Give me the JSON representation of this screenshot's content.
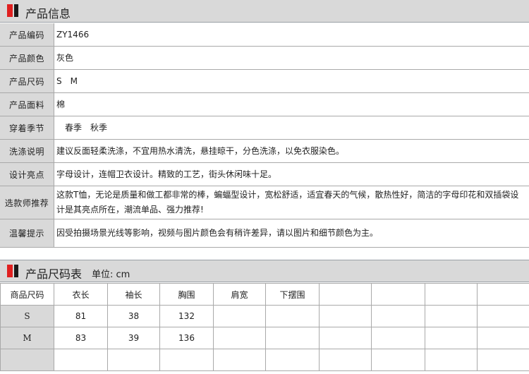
{
  "product_info": {
    "title": "产品信息",
    "rows": [
      {
        "label": "产品编码",
        "value": "ZY1466"
      },
      {
        "label": "产品颜色",
        "value": "灰色"
      },
      {
        "label": "产品尺码",
        "value": "S　M"
      },
      {
        "label": "产品面料",
        "value": "棉"
      },
      {
        "label": "穿着季节",
        "value": "　春季　秋季"
      },
      {
        "label": "洗涤说明",
        "value": "建议反面轻柔洗涤，不宜用热水清洗，悬挂晾干，分色洗涤，以免衣服染色。"
      },
      {
        "label": "设计亮点",
        "value": "字母设计，连帽卫衣设计。精致的工艺，街头休闲味十足。"
      },
      {
        "label": "选款师推荐",
        "value": "这款T恤，无论是质量和做工都非常的棒，蝙蝠型设计，宽松舒适，适宜春天的气候，散热性好，简洁的字母印花和双插袋设计是其亮点所在，潮流单品、强力推荐!"
      },
      {
        "label": "温馨提示",
        "value": "因受拍摄场景光线等影响，视频与图片颜色会有稍许差异，请以图片和细节颜色为主。"
      }
    ]
  },
  "size_chart": {
    "title": "产品尺码表",
    "unit": "单位: cm",
    "columns": [
      "商品尺码",
      "衣长",
      "袖长",
      "胸围",
      "肩宽",
      "下摆围",
      "",
      "",
      "",
      ""
    ],
    "rows": [
      [
        "S",
        "81",
        "38",
        "132",
        "",
        "",
        "",
        "",
        "",
        ""
      ],
      [
        "M",
        "83",
        "39",
        "136",
        "",
        "",
        "",
        "",
        "",
        ""
      ],
      [
        "",
        "",
        "",
        "",
        "",
        "",
        "",
        "",
        "",
        ""
      ]
    ]
  },
  "colors": {
    "header_bg": "#d9d9d9",
    "accent_red": "#e02020",
    "accent_black": "#1a1a1a",
    "border": "#a9a9a9"
  }
}
